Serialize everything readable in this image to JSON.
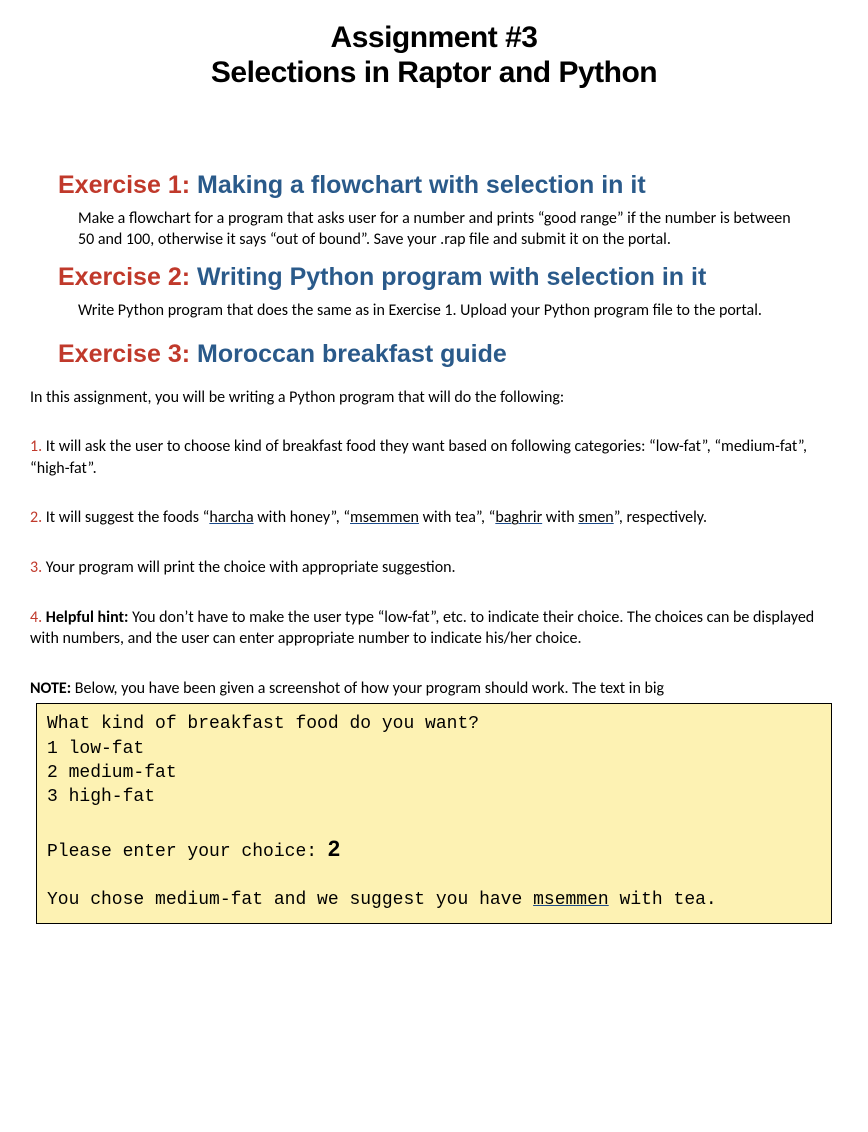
{
  "title": {
    "line1": "Assignment #3",
    "line2": "Selections in Raptor and Python"
  },
  "ex1": {
    "label": "Exercise 1:",
    "title": " Making a flowchart with selection in it",
    "body": "Make a flowchart for a program that asks user for a number and prints “good range” if the number is between 50 and 100, otherwise it says “out of bound”. Save your .rap file and submit it on the portal."
  },
  "ex2": {
    "label": "Exercise 2:",
    "title": " Writing Python program with selection in it",
    "body": "Write Python program that does the same as in Exercise 1. Upload your Python program file to the portal."
  },
  "ex3": {
    "label": "Exercise 3:",
    "title": " Moroccan breakfast guide",
    "intro": "In this assignment, you will be writing a Python program that will do the following:",
    "p1": {
      "num": "1.",
      "text": " It will ask the user to choose kind of breakfast food they want based on following categories: “low-fat”, “medium-fat”, “high-fat”."
    },
    "p2": {
      "num": "2.",
      "pre": " It will suggest the foods “",
      "w1": "harcha",
      "mid1": " with honey”, “",
      "w2": "msemmen",
      "mid2": " with tea”, “",
      "w3": "baghrir",
      "mid3": " with ",
      "w4": "smen",
      "post": "”, respectively."
    },
    "p3": {
      "num": "3.",
      "text": " Your program will print the choice with appropriate suggestion."
    },
    "p4": {
      "num": "4.",
      "hint_label": " Helpful hint:",
      "text": " You don’t have to make the user type “low-fat”, etc. to indicate their choice. The choices can be displayed with numbers, and the user can enter appropriate number to indicate his/her choice."
    },
    "note": {
      "label": "NOTE:",
      "text": " Below, you have been given a screenshot of how your program should work. The text in big"
    }
  },
  "output": {
    "l1": "What kind of breakfast food do you want?",
    "l2": "1 low-fat",
    "l3": "2 medium-fat",
    "l4": "3 high-fat",
    "prompt": "Please enter your choice: ",
    "input": "2",
    "res_pre": "You chose medium-fat and we suggest you have ",
    "res_w": "msemmen",
    "res_post": " with tea."
  }
}
